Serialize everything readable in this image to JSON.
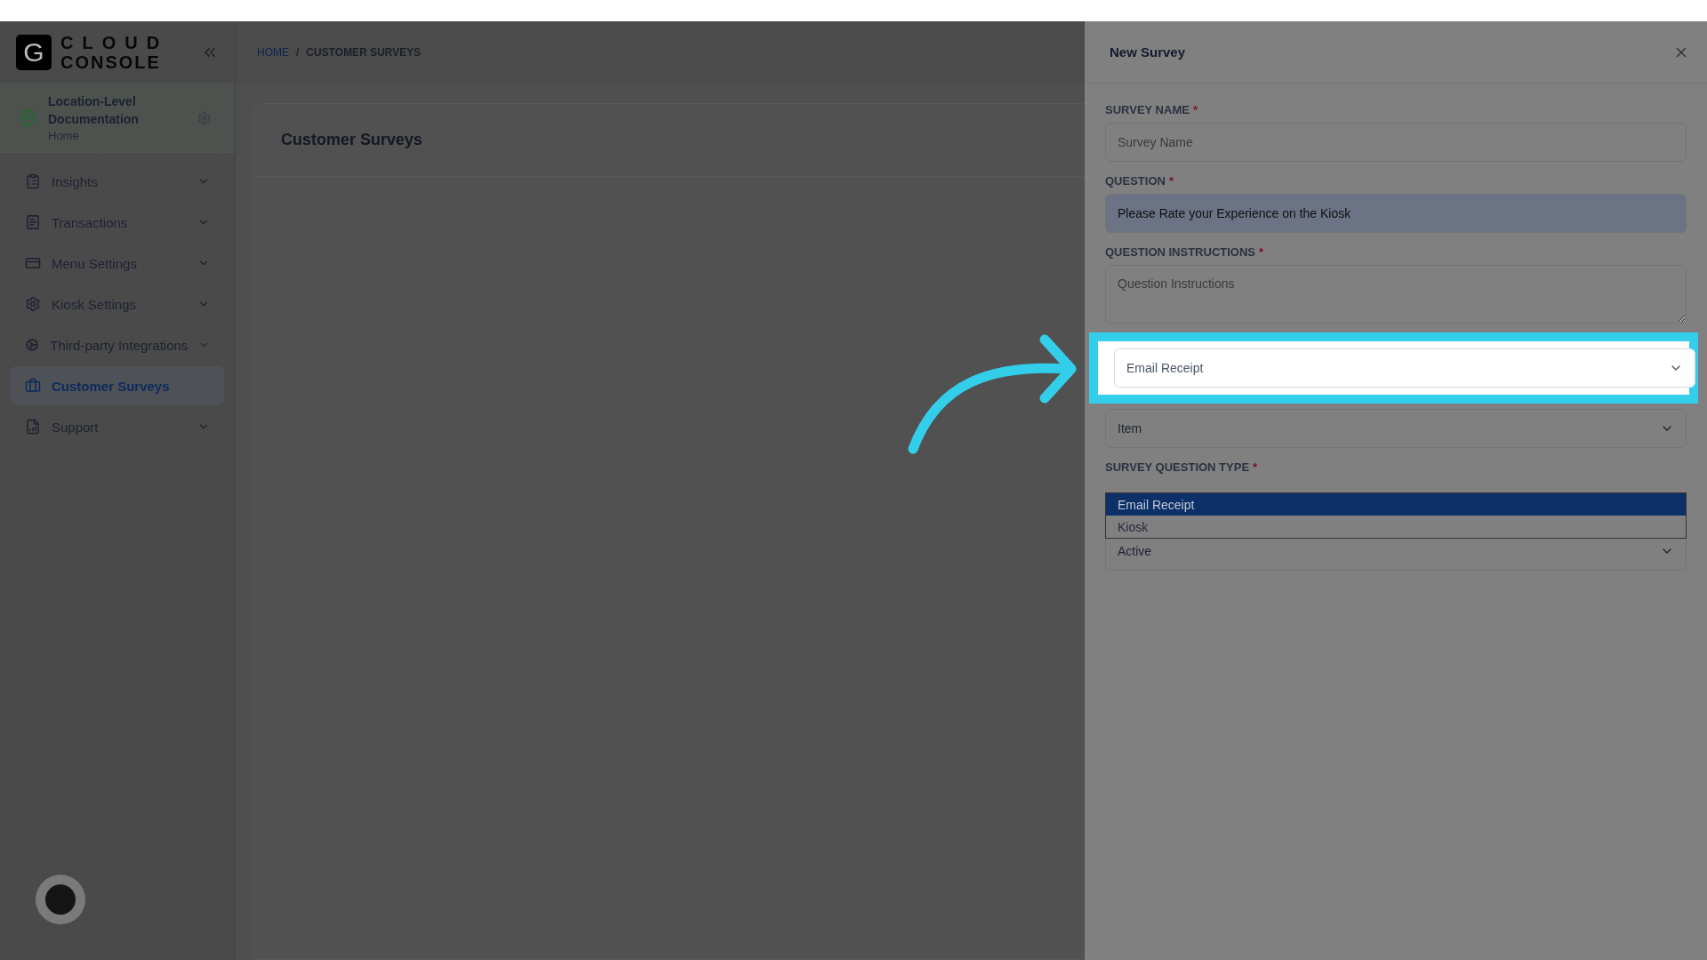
{
  "logo": {
    "mark": "G",
    "line1": "CLOUD",
    "line2": "CONSOLE"
  },
  "location": {
    "title": "Location-Level Documentation",
    "subtitle": "Home"
  },
  "sidebar": {
    "items": [
      {
        "label": "Insights",
        "selected": false,
        "expandable": true
      },
      {
        "label": "Transactions",
        "selected": false,
        "expandable": true
      },
      {
        "label": "Menu Settings",
        "selected": false,
        "expandable": true
      },
      {
        "label": "Kiosk Settings",
        "selected": false,
        "expandable": true
      },
      {
        "label": "Third-party Integrations",
        "selected": false,
        "expandable": true
      },
      {
        "label": "Customer Surveys",
        "selected": true,
        "expandable": false
      },
      {
        "label": "Support",
        "selected": false,
        "expandable": true
      }
    ]
  },
  "breadcrumb": {
    "separator": "/",
    "items": [
      {
        "label": "HOME",
        "link": true
      },
      {
        "label": "CUSTOMER SURVEYS",
        "link": false
      }
    ]
  },
  "page": {
    "title": "Customer Surveys"
  },
  "drawer": {
    "title": "New Survey",
    "fields": [
      {
        "kind": "text",
        "label": "SURVEY NAME",
        "required_mark": "*",
        "placeholder": "Survey Name",
        "disabled": false,
        "highlighted": false
      },
      {
        "kind": "text",
        "label": "QUESTION",
        "required_mark": "*",
        "value": "Please Rate your Experience on the Kiosk",
        "disabled": true,
        "highlighted": false
      },
      {
        "kind": "textarea",
        "label": "QUESTION INSTRUCTIONS",
        "required_mark": "*",
        "placeholder": "Question Instructions",
        "highlighted": false
      },
      {
        "kind": "select",
        "value": "Email Receipt",
        "highlighted": true
      },
      {
        "kind": "select",
        "value": "Item",
        "highlighted": false
      },
      {
        "kind": "select",
        "label": "SURVEY QUESTION TYPE",
        "required_mark": "*",
        "highlighted": false,
        "options": [
          {
            "label": "Email Receipt",
            "selected": true
          },
          {
            "label": "Kiosk",
            "selected": false
          }
        ]
      },
      {
        "kind": "select",
        "value": "Active",
        "highlighted": false
      }
    ]
  }
}
